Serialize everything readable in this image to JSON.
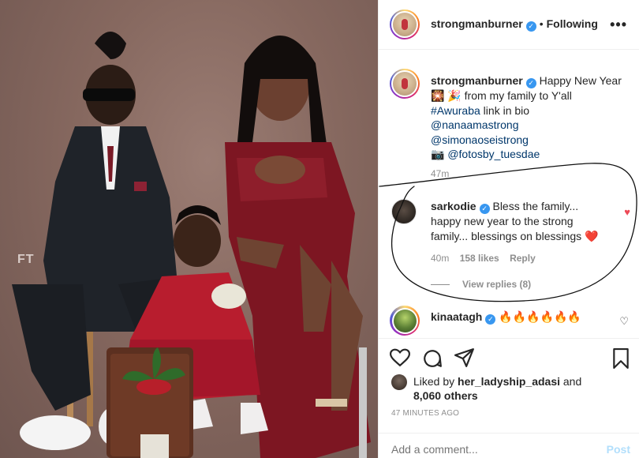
{
  "photo": {
    "watermark": "FT"
  },
  "header": {
    "username": "strongmanburner",
    "separator": "•",
    "follow_status": "Following",
    "more": "•••"
  },
  "caption": {
    "username": "strongmanburner",
    "line1": "Happy New Year",
    "line2": "🎇 🎉 from my family to Y'all",
    "hashtag": "#Awuraba",
    "after_hashtag": " link in bio",
    "mention1": "@nanaamastrong",
    "mention2": "@simonaoseistrong",
    "camera": "📷",
    "mention3": "@fotosby_tuesdae",
    "time": "47m"
  },
  "comment1": {
    "username": "sarkodie",
    "text": "Bless the family... happy new year to the strong family... blessings on blessings",
    "emoji": "❤️",
    "time": "40m",
    "likes": "158 likes",
    "reply": "Reply",
    "view_replies": "View replies (8)"
  },
  "comment2": {
    "username": "kinaatagh",
    "text": "🔥🔥🔥🔥🔥🔥"
  },
  "likes": {
    "prefix": "Liked by ",
    "user": "her_ladyship_adasi",
    "and": " and",
    "others": "8,060 others"
  },
  "post_time": "47 MINUTES AGO",
  "add_comment": {
    "placeholder": "Add a comment...",
    "post": "Post"
  },
  "colors": {
    "verified": "#3897f0",
    "link": "#00376b",
    "heart": "#ed4956",
    "muted": "#8e8e8e"
  }
}
